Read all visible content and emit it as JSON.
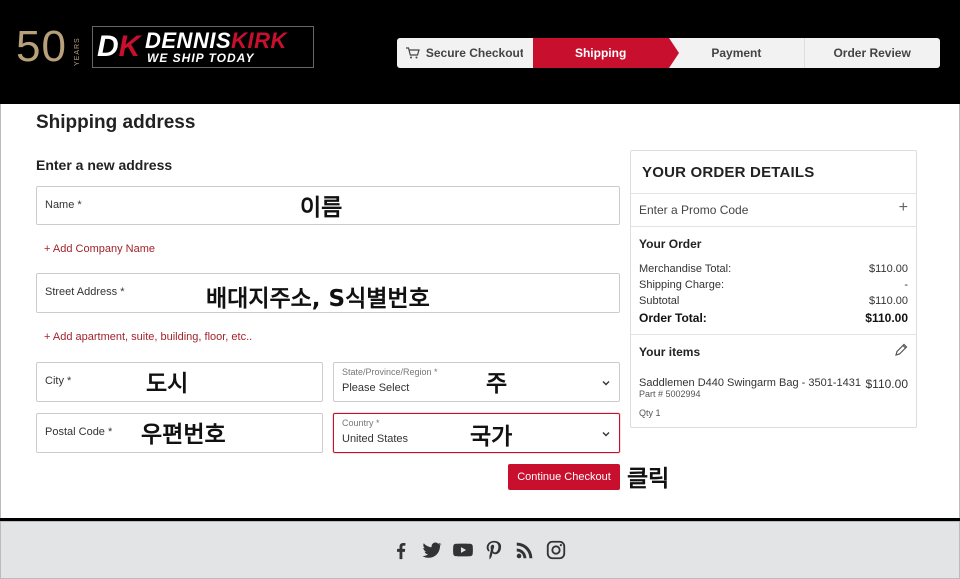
{
  "brand": {
    "years_number": "50",
    "years_label": "YEARS",
    "monogram_d": "D",
    "monogram_k": "K",
    "name_part1": "DENNIS",
    "name_part2": "KIRK",
    "tagline": "WE SHIP TODAY",
    "colors": {
      "accent": "#c8102e",
      "gold": "#b8a07a"
    }
  },
  "steps": [
    {
      "label": "Secure Checkout",
      "icon": "cart-icon",
      "state": "done"
    },
    {
      "label": "Shipping",
      "state": "active"
    },
    {
      "label": "Payment",
      "state": "upcoming"
    },
    {
      "label": "Order Review",
      "state": "upcoming"
    }
  ],
  "page_title": "Shipping address",
  "form": {
    "section_title": "Enter a new address",
    "name_label": "Name *",
    "add_company": "+ Add Company Name",
    "street_label": "Street Address *",
    "add_apartment": "+ Add apartment, suite, building, floor, etc..",
    "city_label": "City *",
    "state_label": "State/Province/Region *",
    "state_value": "Please Select",
    "postal_label": "Postal Code *",
    "country_label": "Country *",
    "country_value": "United States",
    "continue_button": "Continue Checkout"
  },
  "annotations": {
    "name": "이름",
    "street": "배대지주소, S식별번호",
    "city": "도시",
    "state": "주",
    "postal": "우편번호",
    "country": "국가",
    "click": "클릭"
  },
  "order_details": {
    "title": "YOUR ORDER DETAILS",
    "promo_label": "Enter a Promo Code",
    "promo_toggle": "+",
    "your_order_title": "Your Order",
    "rows": [
      {
        "label": "Merchandise Total:",
        "value": "$110.00"
      },
      {
        "label": "Shipping Charge:",
        "value": "-"
      },
      {
        "label": "Subtotal",
        "value": "$110.00"
      },
      {
        "label": "Order Total:",
        "value": "$110.00"
      }
    ],
    "items_title": "Your items",
    "item": {
      "name": "Saddlemen D440 Swingarm Bag - 3501-1431",
      "price": "$110.00",
      "part": "Part # 5002994",
      "qty": "Qty 1"
    }
  },
  "footer": {
    "social": [
      "facebook-icon",
      "twitter-icon",
      "youtube-icon",
      "pinterest-icon",
      "rss-icon",
      "instagram-icon"
    ]
  }
}
